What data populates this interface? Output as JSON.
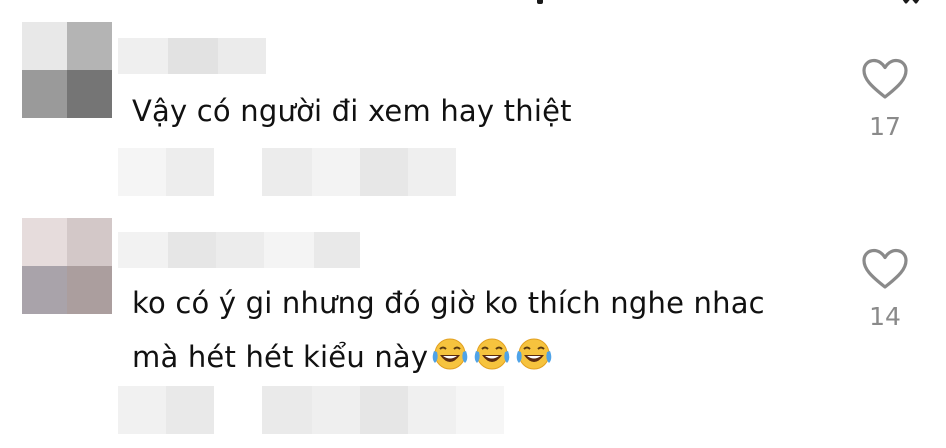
{
  "comments": [
    {
      "text": "Vậy có người đi xem hay thiệt",
      "like_count": "17",
      "avatar_tiles": [
        "#e8e8e8",
        "#b4b4b4",
        "#9a9a9a",
        "#757575"
      ]
    },
    {
      "text": "ko có ý gi nhưng đó giờ ko thích nghe nhac mà hét hét kiểu này",
      "like_count": "14",
      "avatar_tiles": [
        "#e6dcdc",
        "#d3c8c8",
        "#a9a3aa",
        "#ab9e9e"
      ],
      "emoji": [
        "face-with-tears-of-joy-icon",
        "face-with-tears-of-joy-icon",
        "face-with-tears-of-joy-icon"
      ]
    }
  ],
  "colors": {
    "text": "#111111",
    "like_count": "#8a8a8a",
    "heart_outline": "#8a8a8a",
    "blur_light": "#f0f0f0",
    "blur_mid": "#e4e4e4"
  }
}
